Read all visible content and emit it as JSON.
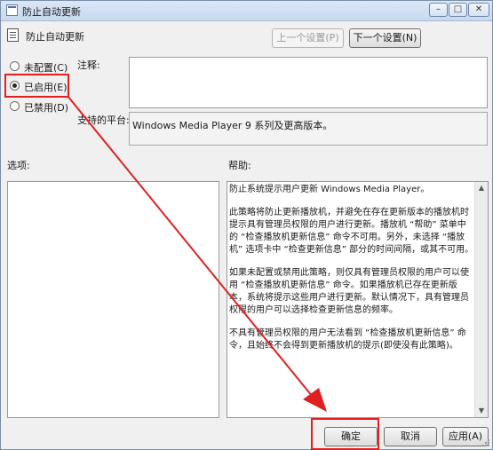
{
  "window": {
    "title": "防止自动更新",
    "minimize_glyph": "–",
    "maximize_glyph": "□",
    "close_glyph": "✕"
  },
  "header": {
    "policy_name": "防止自动更新",
    "prev_button": "上一个设置(P)",
    "next_button": "下一个设置(N)"
  },
  "state_options": {
    "items": [
      {
        "label": "未配置(C)",
        "checked": false
      },
      {
        "label": "已启用(E)",
        "checked": true
      },
      {
        "label": "已禁用(D)",
        "checked": false
      }
    ]
  },
  "comment": {
    "label": "注释:",
    "value": ""
  },
  "platform": {
    "label": "支持的平台:",
    "value": "Windows Media Player 9 系列及更高版本。"
  },
  "options": {
    "label": "选项:"
  },
  "help": {
    "label": "帮助:",
    "paragraphs": [
      "防止系统提示用户更新 Windows Media Player。",
      "此策略将防止更新播放机，并避免在存在更新版本的播放机时提示具有管理员权限的用户进行更新。播放机 “帮助” 菜单中的 “检查播放机更新信息” 命令不可用。另外，未选择 “播放机” 选项卡中 “检查更新信息” 部分的时间间隔，或其不可用。",
      "如果未配置或禁用此策略，则仅具有管理员权限的用户可以使用 “检查播放机更新信息” 命令。如果播放机已存在更新版本，系统将提示这些用户进行更新。默认情况下，具有管理员权限的用户可以选择检查更新信息的频率。",
      "不具有管理员权限的用户无法看到 “检查播放机更新信息” 命令，且始终不会得到更新播放机的提示(即使没有此策略)。"
    ]
  },
  "footer": {
    "ok_button": "确定",
    "cancel_button": "取消",
    "apply_button": "应用(A)"
  },
  "annotation": {
    "color": "#e02020"
  }
}
